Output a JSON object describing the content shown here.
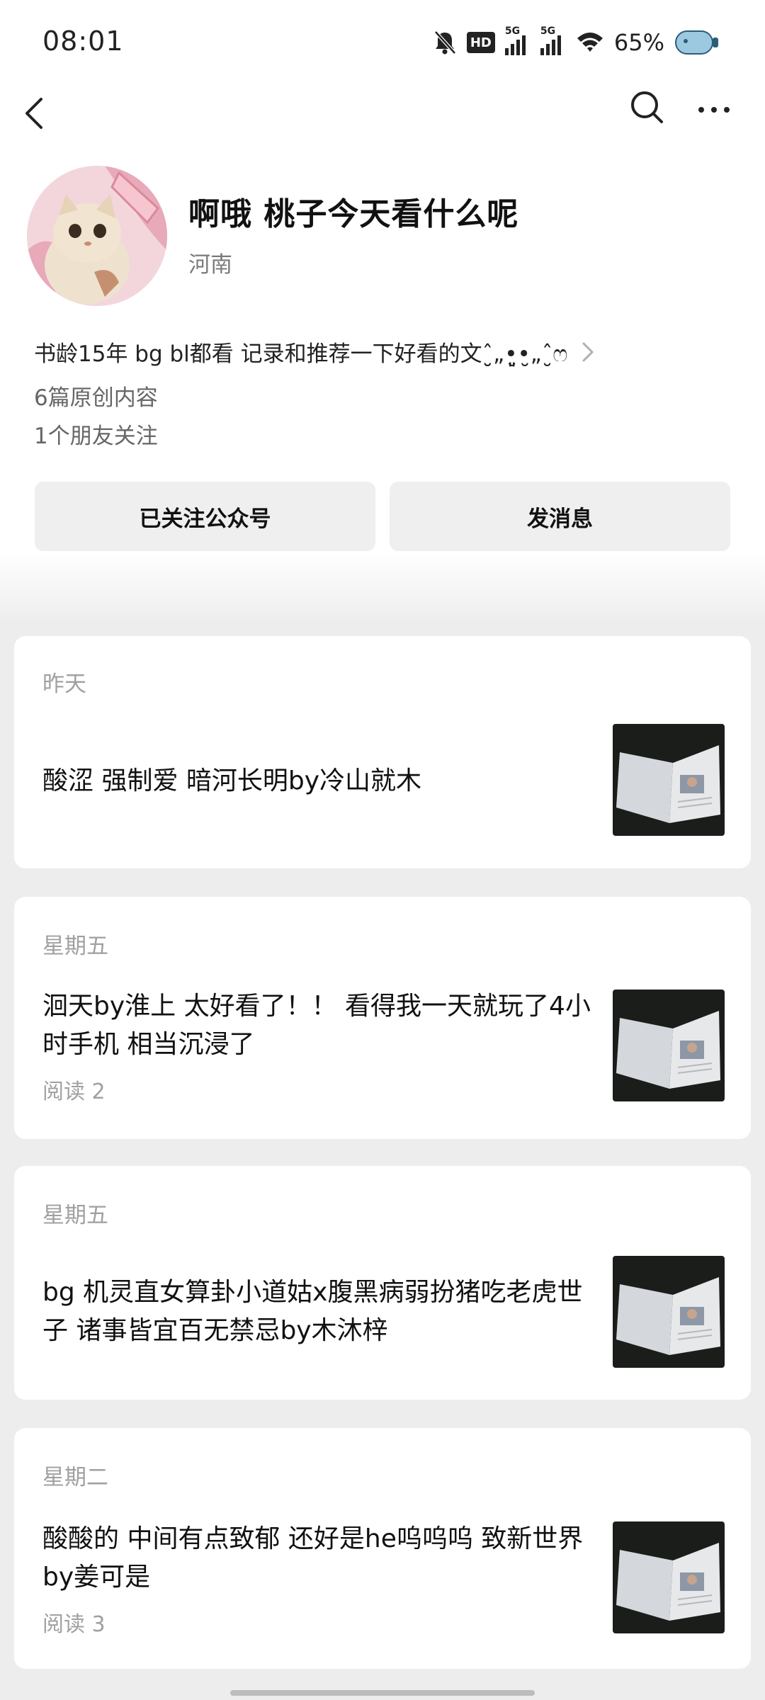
{
  "status_bar": {
    "time": "08:01",
    "network_labels": [
      "5G",
      "5G"
    ],
    "hd_label": "HD",
    "battery": "65%"
  },
  "header": {
    "back_icon": "chevron-left-icon",
    "search_icon": "search-icon",
    "more_icon": "more-horizontal-icon"
  },
  "profile": {
    "name": "啊哦 桃子今天看什么呢",
    "region": "河南",
    "bio": "书龄15年  bg bl都看 记录和推荐一下好看的文ˆ̮̮„•͈̮•̮„ˆ̮ෆ",
    "original_count": "6篇原创内容",
    "friends_follow": "1个朋友关注",
    "follow_button": "已关注公众号",
    "message_button": "发消息"
  },
  "articles": [
    {
      "date": "昨天",
      "title": "酸涩 强制爱  暗河长明by冷山就木",
      "read": ""
    },
    {
      "date": "星期五",
      "title": "洄天by淮上  太好看了！！ 看得我一天就玩了4小时手机 相当沉浸了",
      "read": "阅读 2"
    },
    {
      "date": "星期五",
      "title": "bg 机灵直女算卦小道姑x腹黑病弱扮猪吃老虎世子  诸事皆宜百无禁忌by木沐梓",
      "read": ""
    },
    {
      "date": "星期二",
      "title": "酸酸的 中间有点致郁 还好是he呜呜呜  致新世界by姜可是",
      "read": "阅读 3"
    }
  ]
}
